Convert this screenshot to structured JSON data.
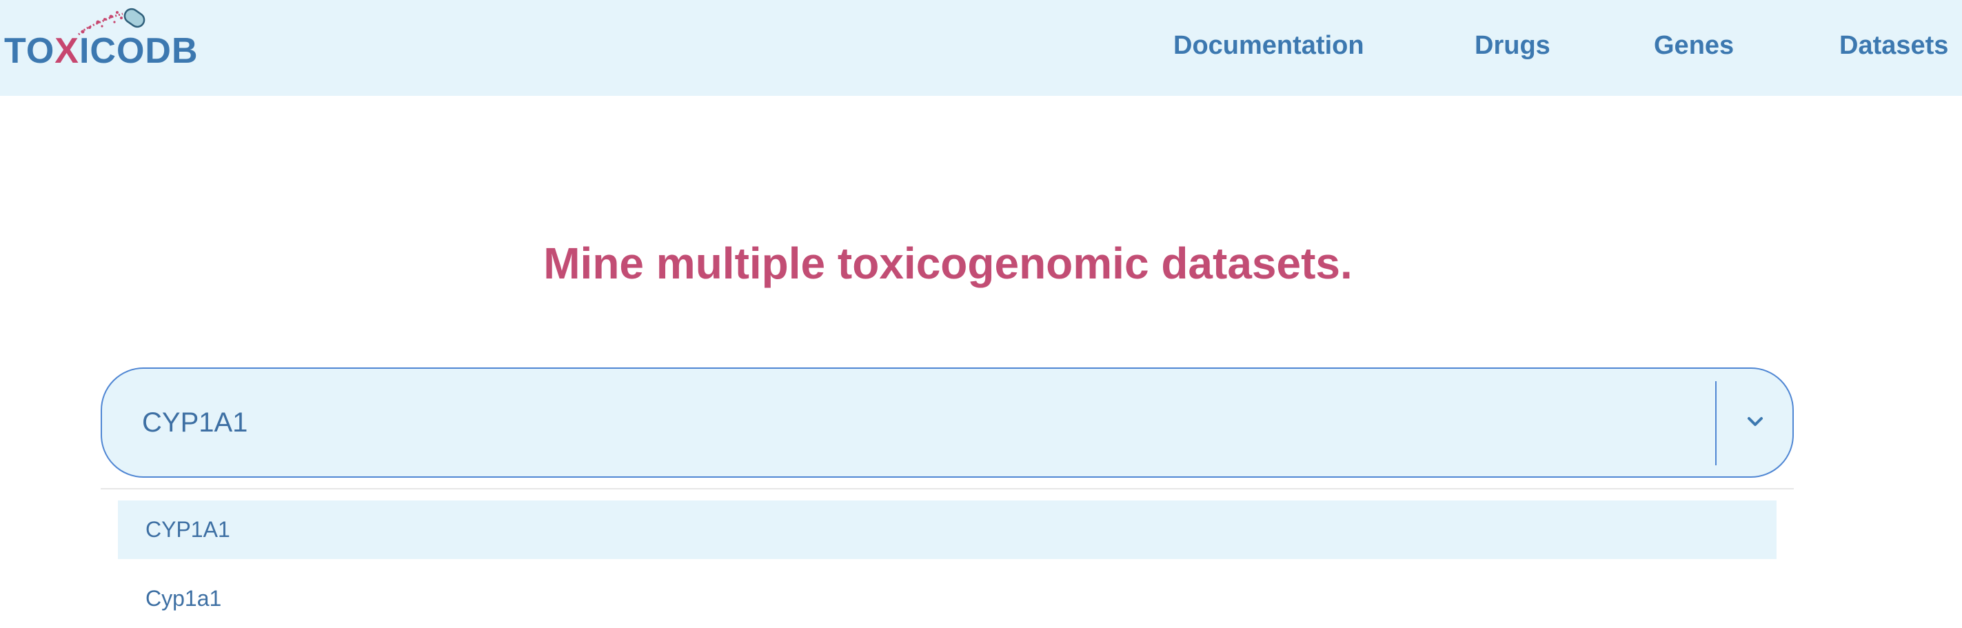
{
  "logo": {
    "part1": "TO",
    "part2": "X",
    "part3": "ICODB"
  },
  "nav": {
    "links": [
      {
        "label": "Documentation"
      },
      {
        "label": "Drugs"
      },
      {
        "label": "Genes"
      },
      {
        "label": "Datasets"
      }
    ]
  },
  "hero": {
    "title": "Mine multiple toxicogenomic datasets."
  },
  "search": {
    "value": "CYP1A1"
  },
  "dropdown": {
    "options": [
      {
        "label": "CYP1A1",
        "highlighted": true
      },
      {
        "label": "Cyp1a1",
        "highlighted": false
      }
    ]
  },
  "colors": {
    "navbar_bg": "#e5f4fb",
    "brand_blue": "#3c78b0",
    "brand_pink": "#c7466f",
    "hero_title": "#c24d74",
    "input_border": "#4f86d3"
  },
  "icons": {
    "logo_mark": "pill-icon",
    "dropdown_toggle": "chevron-down-icon"
  }
}
